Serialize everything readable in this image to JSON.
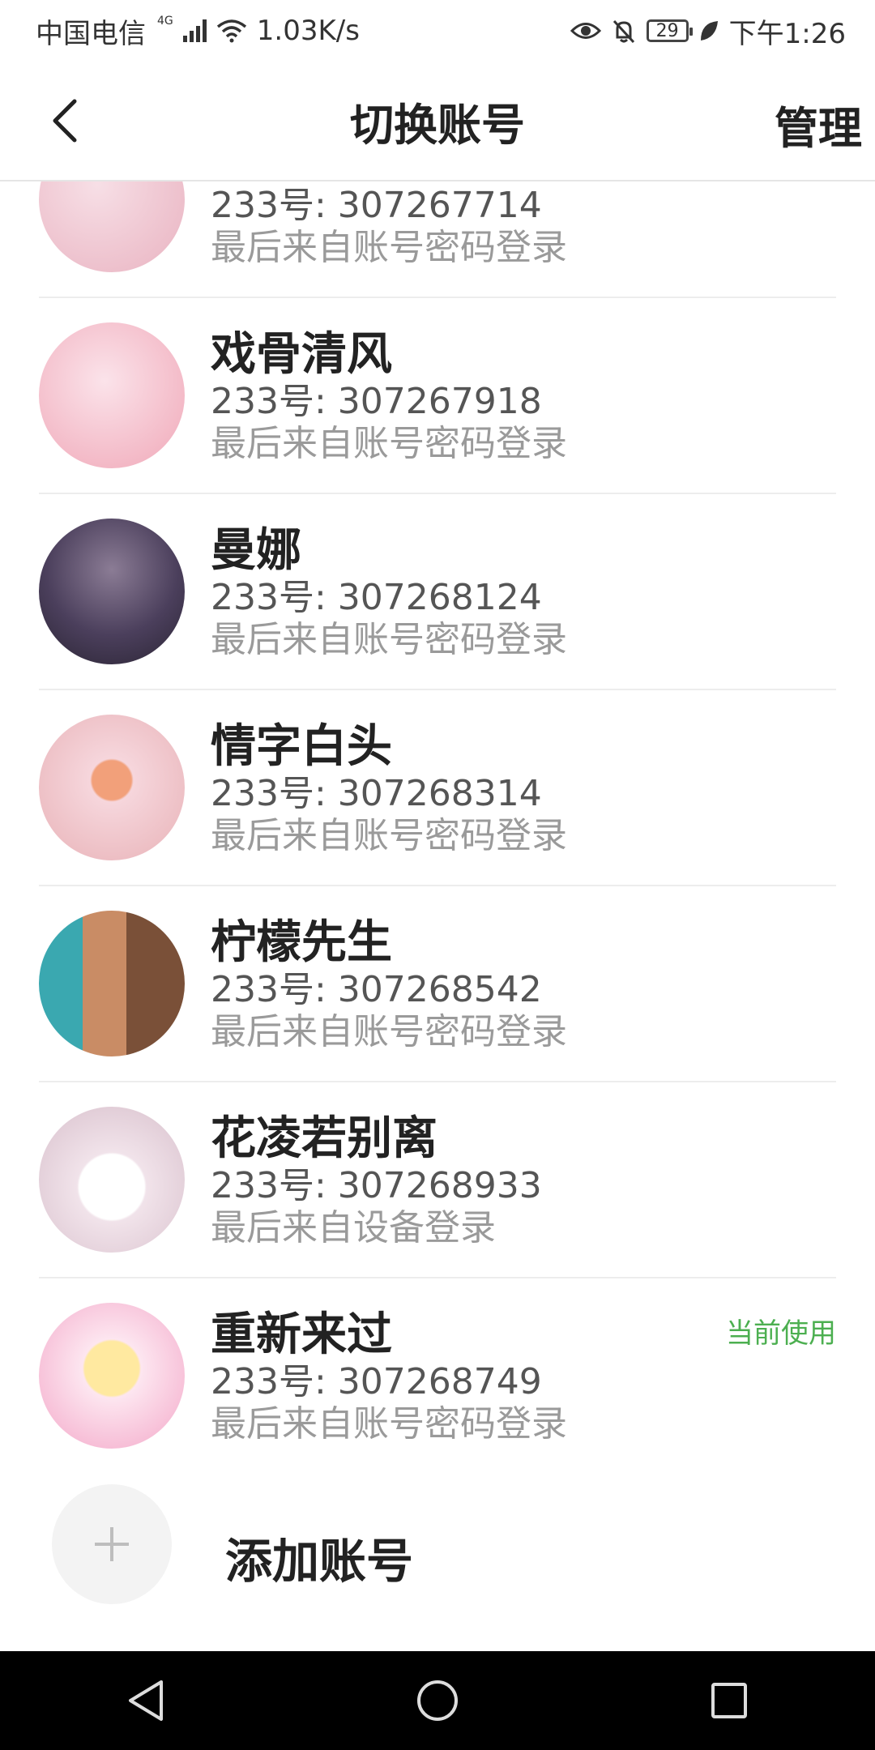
{
  "status_bar": {
    "carrier": "中国电信",
    "network_type": "4G",
    "speed": "1.03K/s",
    "battery": "29",
    "time": "下午1:26"
  },
  "header": {
    "title": "切换账号",
    "manage_label": "管理",
    "back_icon": "chevron-left-icon"
  },
  "accounts": [
    {
      "name": "",
      "id": "233号: 307267714",
      "last_login": "最后来自账号密码登录",
      "avatar_colors": [
        "#f7dfe6",
        "#e9b3c1"
      ]
    },
    {
      "name": "戏骨清风",
      "id": "233号: 307267918",
      "last_login": "最后来自账号密码登录",
      "avatar_colors": [
        "#fbe3ea",
        "#f0a8b8"
      ]
    },
    {
      "name": "曼娜",
      "id": "233号: 307268124",
      "last_login": "最后来自账号密码登录",
      "avatar_colors": [
        "#4b3f5c",
        "#2a2433"
      ]
    },
    {
      "name": "情字白头",
      "id": "233号: 307268314",
      "last_login": "最后来自账号密码登录",
      "avatar_colors": [
        "#f6d6dc",
        "#e8b2b7"
      ]
    },
    {
      "name": "柠檬先生",
      "id": "233号: 307268542",
      "last_login": "最后来自账号密码登录",
      "avatar_colors": [
        "#3aa8b0",
        "#7a5038"
      ]
    },
    {
      "name": "花凌若别离",
      "id": "233号: 307268933",
      "last_login": "最后来自设备登录",
      "avatar_colors": [
        "#f1e3ea",
        "#d8c0cc"
      ]
    },
    {
      "name": "重新来过",
      "id": "233号: 307268749",
      "last_login": "最后来自账号密码登录",
      "avatar_colors": [
        "#fde6f0",
        "#f3a7c8"
      ],
      "badge": "当前使用"
    }
  ],
  "add_account": {
    "label": "添加账号",
    "icon": "plus-icon"
  },
  "colors": {
    "accent_green": "#4caf50",
    "divider": "#ededed",
    "nav_bar": "#000000"
  }
}
